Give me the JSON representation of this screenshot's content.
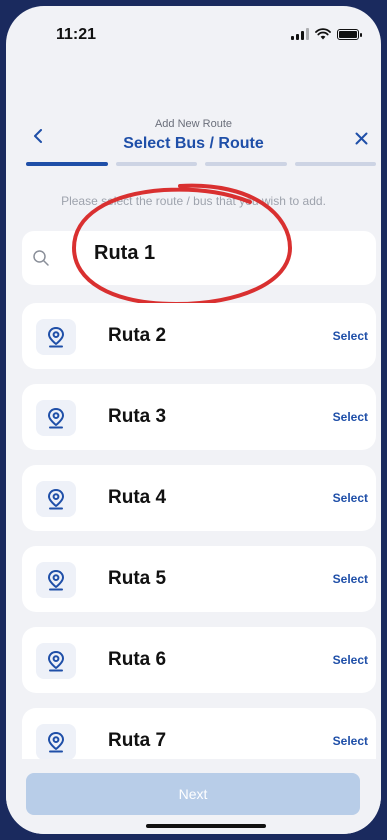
{
  "status": {
    "time": "11:21"
  },
  "header": {
    "subtitle": "Add New Route",
    "title": "Select Bus / Route",
    "steps_total": 4,
    "steps_active": 1
  },
  "instruction": "Please select the route / bus that you wish to add.",
  "search": {
    "value": "Ruta 1"
  },
  "routes": [
    {
      "label": "Ruta 2",
      "action": "Select"
    },
    {
      "label": "Ruta 3",
      "action": "Select"
    },
    {
      "label": "Ruta 4",
      "action": "Select"
    },
    {
      "label": "Ruta 5",
      "action": "Select"
    },
    {
      "label": "Ruta 6",
      "action": "Select"
    },
    {
      "label": "Ruta 7",
      "action": "Select"
    }
  ],
  "footer": {
    "next_label": "Next"
  },
  "colors": {
    "accent": "#1f4fa8",
    "progress_active": "#1f4fa8",
    "annotation": "#d93030",
    "next_disabled": "#b8cde8"
  },
  "icons": {
    "back": "chevron-left-icon",
    "close": "close-icon",
    "search": "search-icon",
    "route": "location-pin-icon"
  }
}
